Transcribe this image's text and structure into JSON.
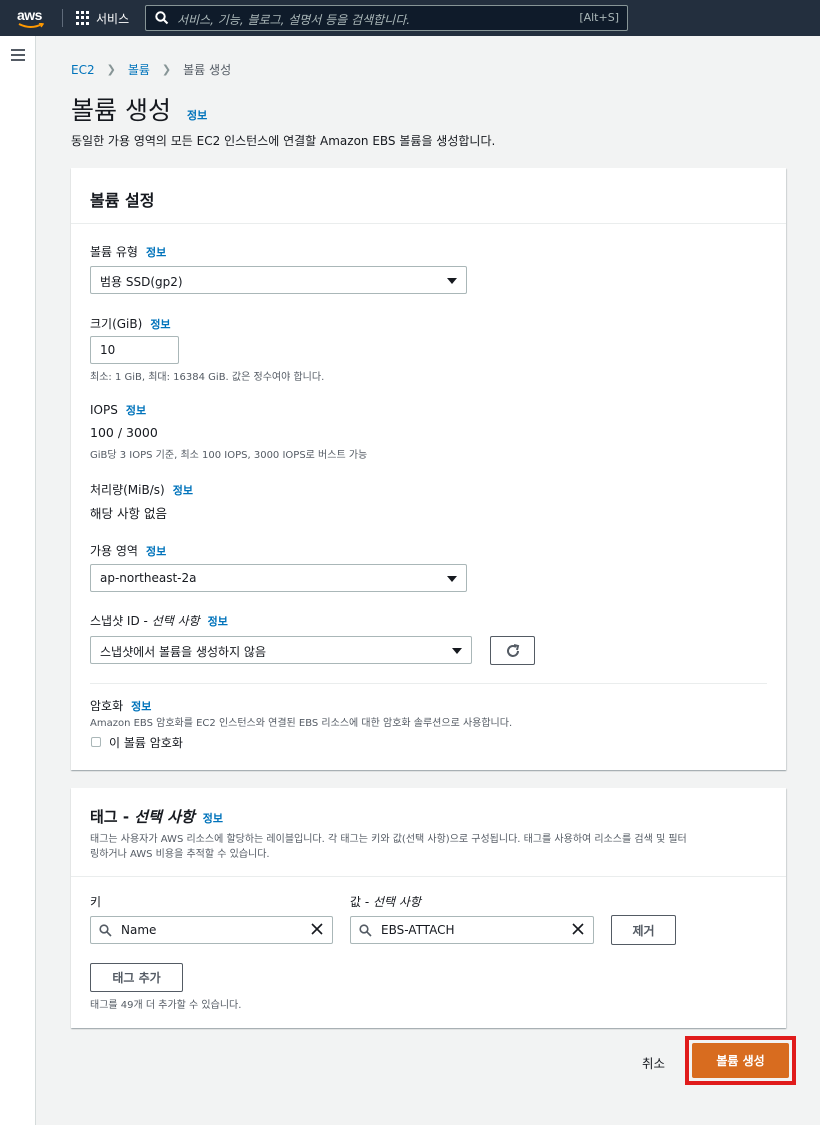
{
  "nav": {
    "logo_text": "aws",
    "services_label": "서비스",
    "search_placeholder": "서비스, 기능, 블로그, 설명서 등을 검색합니다.",
    "search_shortcut": "[Alt+S]"
  },
  "breadcrumb": {
    "items": [
      "EC2",
      "볼륨",
      "볼륨 생성"
    ]
  },
  "page": {
    "title": "볼륨 생성",
    "info": "정보",
    "description": "동일한 가용 영역의 모든 EC2 인스턴스에 연결할 Amazon EBS 볼륨을 생성합니다."
  },
  "volume_settings": {
    "header": "볼륨 설정",
    "volume_type": {
      "label": "볼륨 유형",
      "info": "정보",
      "value": "범용 SSD(gp2)"
    },
    "size": {
      "label": "크기(GiB)",
      "info": "정보",
      "value": "10",
      "hint": "최소: 1 GiB, 최대: 16384 GiB. 값은 정수여야 합니다."
    },
    "iops": {
      "label": "IOPS",
      "info": "정보",
      "value": "100 / 3000",
      "hint": "GiB당 3 IOPS 기준, 최소 100 IOPS, 3000 IOPS로 버스트 가능"
    },
    "throughput": {
      "label": "처리량(MiB/s)",
      "info": "정보",
      "value": "해당 사항 없음"
    },
    "availability_zone": {
      "label": "가용 영역",
      "info": "정보",
      "value": "ap-northeast-2a"
    },
    "snapshot": {
      "label_prefix": "스냅샷 ID - ",
      "label_optional": "선택 사항",
      "info": "정보",
      "value": "스냅샷에서 볼륨을 생성하지 않음"
    },
    "encryption": {
      "label": "암호화",
      "info": "정보",
      "description": "Amazon EBS 암호화를 EC2 인스턴스와 연결된 EBS 리소스에 대한 암호화 솔루션으로 사용합니다.",
      "checkbox_label": "이 볼륨 암호화",
      "checked": false
    }
  },
  "tags": {
    "header_prefix": "태그 - ",
    "header_optional": "선택 사항",
    "info": "정보",
    "description_line1": "태그는 사용자가 AWS 리소스에 할당하는 레이블입니다. 각 태그는 키와 값(선택 사항)으로 구성됩니다. 태그를 사용하여 리소스를 검색 및 필터",
    "description_line2": "링하거나 AWS 비용을 추적할 수 있습니다.",
    "key_label": "키",
    "value_label_prefix": "값 - ",
    "value_label_optional": "선택 사항",
    "rows": [
      {
        "key": "Name",
        "value": "EBS-ATTACH"
      }
    ],
    "remove_label": "제거",
    "add_label": "태그 추가",
    "remaining_hint": "태그를 49개 더 추가할 수 있습니다."
  },
  "footer": {
    "cancel_label": "취소",
    "create_label": "볼륨 생성"
  },
  "colors": {
    "nav_bg": "#232f3e",
    "link": "#0073bb",
    "primary_button": "#d86c1f",
    "highlight_outline": "#e01b1b"
  }
}
